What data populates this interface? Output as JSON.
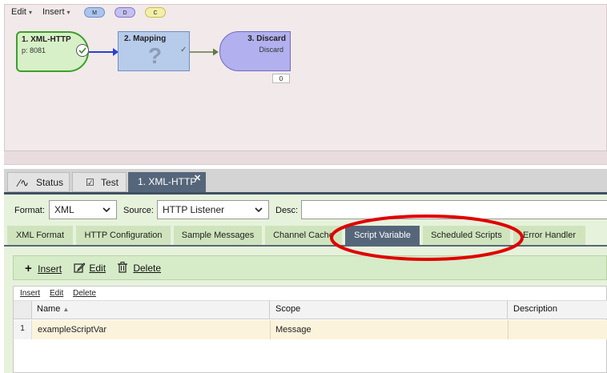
{
  "canvas": {
    "menus": [
      {
        "label": "Edit"
      },
      {
        "label": "Insert"
      }
    ],
    "pills": [
      "M",
      "D",
      "C"
    ],
    "nodes": [
      {
        "title": "1. XML-HTTP",
        "subtitle": "p: 8081"
      },
      {
        "title": "2. Mapping",
        "glyph": "?"
      },
      {
        "title": "3. Discard",
        "subtitle": "Discard",
        "count": "0"
      }
    ]
  },
  "panel_tabs": [
    {
      "label": "Status",
      "icon": "pulse-icon"
    },
    {
      "label": "Test",
      "icon": "checkbox-icon"
    },
    {
      "label": "1. XML-HTTP",
      "close": "✕"
    }
  ],
  "form": {
    "format_label": "Format:",
    "format_value": "XML",
    "source_label": "Source:",
    "source_value": "HTTP Listener",
    "desc_label": "Desc:",
    "desc_value": ""
  },
  "sub_tabs": [
    "XML Format",
    "HTTP Configuration",
    "Sample Messages",
    "Channel Cache",
    "Script Variable",
    "Scheduled Scripts",
    "Error Handler"
  ],
  "active_sub_tab": "Script Variable",
  "toolbar": {
    "insert_label": "Insert",
    "edit_label": "Edit",
    "delete_label": "Delete"
  },
  "grid": {
    "mini_menu": [
      "Insert",
      "Edit",
      "Delete"
    ],
    "columns": [
      "Name",
      "Scope",
      "Description"
    ],
    "rows": [
      {
        "num": "1",
        "name": "exampleScriptVar",
        "scope": "Message",
        "description": ""
      }
    ]
  },
  "annotation": {
    "color": "#e00000"
  }
}
